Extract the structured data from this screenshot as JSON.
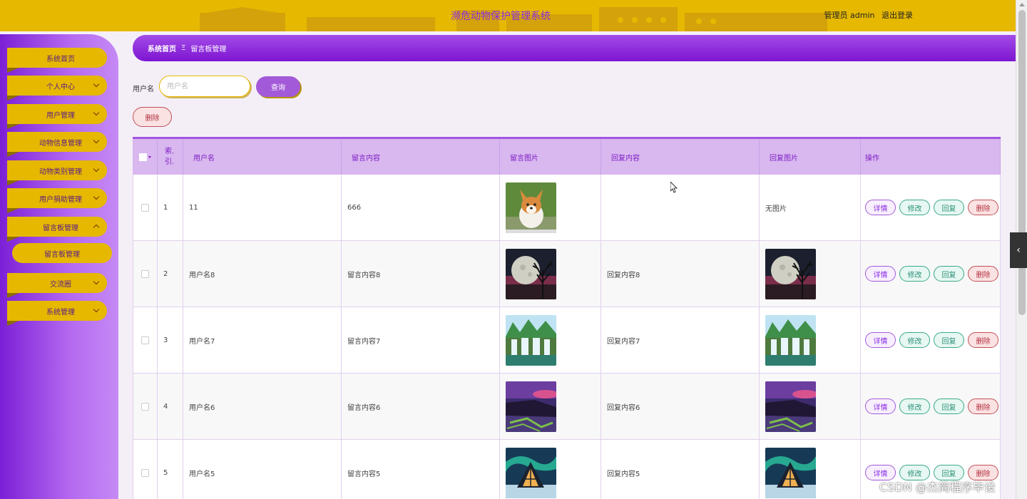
{
  "header": {
    "title": "濒危动物保护管理系统",
    "user_role": "管理员 admin",
    "logout_label": "退出登录",
    "bar_color": "#e6b800",
    "title_color": "#8a2be2"
  },
  "sidebar": {
    "items": [
      {
        "label": "系统首页",
        "has_chevron": false
      },
      {
        "label": "个人中心",
        "has_chevron": true
      },
      {
        "label": "用户管理",
        "has_chevron": true
      },
      {
        "label": "动物信息管理",
        "has_chevron": true
      },
      {
        "label": "动物类别管理",
        "has_chevron": true
      },
      {
        "label": "用户捐助管理",
        "has_chevron": true
      },
      {
        "label": "留言板管理",
        "has_chevron": true,
        "expanded": true
      },
      {
        "label": "交流圈",
        "has_chevron": true
      },
      {
        "label": "系统管理",
        "has_chevron": true
      }
    ],
    "submenu": {
      "label": "留言板管理"
    }
  },
  "breadcrumb": {
    "home": "系统首页",
    "separator": "Ξ",
    "current": "留言板管理"
  },
  "search": {
    "label": "用户名",
    "placeholder": "用户名",
    "button_label": "查询"
  },
  "actions": {
    "delete_label": "删除"
  },
  "table": {
    "columns": [
      "索引",
      "用户名",
      "留言内容",
      "留言图片",
      "回复内容",
      "回复图片",
      "操作"
    ],
    "index_header_top": "索.",
    "index_header_bottom": "引.",
    "rows": [
      {
        "index": "1",
        "username": "11",
        "content": "666",
        "image": "corgi",
        "reply": "",
        "reply_image": "",
        "reply_image_text": "无图片"
      },
      {
        "index": "2",
        "username": "用户名8",
        "content": "留言内容8",
        "image": "moon",
        "reply": "回复内容8",
        "reply_image": "moon",
        "reply_image_text": ""
      },
      {
        "index": "3",
        "username": "用户名7",
        "content": "留言内容7",
        "image": "waterfall",
        "reply": "回复内容7",
        "reply_image": "waterfall",
        "reply_image_text": ""
      },
      {
        "index": "4",
        "username": "用户名6",
        "content": "留言内容6",
        "image": "coast",
        "reply": "回复内容6",
        "reply_image": "coast",
        "reply_image_text": ""
      },
      {
        "index": "5",
        "username": "用户名5",
        "content": "留言内容5",
        "image": "aurora",
        "reply": "回复内容5",
        "reply_image": "aurora",
        "reply_image_text": ""
      }
    ],
    "ops": {
      "detail": "详情",
      "edit": "修改",
      "reply": "回复",
      "delete": "删除"
    }
  },
  "watermark": "CSDN @杰简程序毕设"
}
